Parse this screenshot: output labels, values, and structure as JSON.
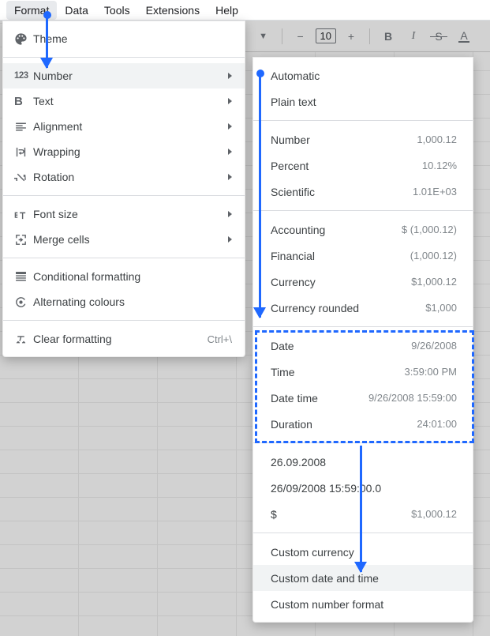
{
  "menubar": {
    "items": [
      "Format",
      "Data",
      "Tools",
      "Extensions",
      "Help"
    ],
    "active_index": 0
  },
  "toolbar": {
    "font_size": "10"
  },
  "format_menu": {
    "theme": "Theme",
    "number": "Number",
    "text": "Text",
    "alignment": "Alignment",
    "wrapping": "Wrapping",
    "rotation": "Rotation",
    "font_size": "Font size",
    "merge_cells": "Merge cells",
    "conditional_formatting": "Conditional formatting",
    "alternating_colours": "Alternating colours",
    "clear_formatting": "Clear formatting",
    "clear_formatting_shortcut": "Ctrl+\\"
  },
  "number_menu": {
    "automatic": "Automatic",
    "plain_text": "Plain text",
    "number": "Number",
    "number_ex": "1,000.12",
    "percent": "Percent",
    "percent_ex": "10.12%",
    "scientific": "Scientific",
    "scientific_ex": "1.01E+03",
    "accounting": "Accounting",
    "accounting_ex": "$ (1,000.12)",
    "financial": "Financial",
    "financial_ex": "(1,000.12)",
    "currency": "Currency",
    "currency_ex": "$1,000.12",
    "currency_rounded": "Currency rounded",
    "currency_rounded_ex": "$1,000",
    "date": "Date",
    "date_ex": "9/26/2008",
    "time": "Time",
    "time_ex": "3:59:00 PM",
    "date_time": "Date time",
    "date_time_ex": "9/26/2008 15:59:00",
    "duration": "Duration",
    "duration_ex": "24:01:00",
    "locale_date": "26.09.2008",
    "locale_datetime": "26/09/2008 15:59:00.0",
    "dollar": "$",
    "dollar_ex": "$1,000.12",
    "custom_currency": "Custom currency",
    "custom_date_time": "Custom date and time",
    "custom_number_format": "Custom number format"
  }
}
